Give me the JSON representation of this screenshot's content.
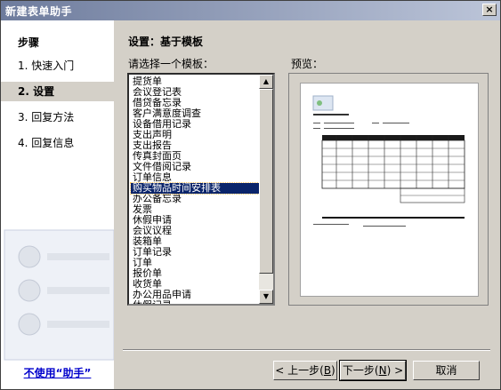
{
  "window": {
    "title": "新建表单助手",
    "close_glyph": "×"
  },
  "sidebar": {
    "heading": "步骤",
    "steps": [
      {
        "label": "1. 快速入门"
      },
      {
        "label": "2. 设置"
      },
      {
        "label": "3. 回复方法"
      },
      {
        "label": "4. 回复信息"
      }
    ],
    "no_wizard_link": "不使用“助手”"
  },
  "main": {
    "section_title": "设置：基于模板",
    "template_label": "请选择一个模板：",
    "preview_label": "预览：",
    "templates": [
      "提货单",
      "会议登记表",
      "借贷备忘录",
      "客户满意度调查",
      "设备借用记录",
      "支出声明",
      "支出报告",
      "传真封面页",
      "文件借阅记录",
      "订单信息",
      "购买物品时间安排表",
      "办公备忘录",
      "发票",
      "休假申请",
      "会议议程",
      "装箱单",
      "订单记录",
      "订单",
      "报价单",
      "收货单",
      "办公用品申请",
      "休假记录"
    ],
    "selected_template": "购买物品时间安排表"
  },
  "buttons": {
    "back": "< 上一步",
    "back_key": "B",
    "next": "下一步",
    "next_key": "N",
    "next_suffix": " >",
    "cancel": "取消"
  },
  "scrollbar": {
    "up_glyph": "▲",
    "down_glyph": "▼"
  },
  "colors": {
    "selection": "#0a246a",
    "link": "#0000cc",
    "titlebar_start": "#6e7c9d"
  }
}
